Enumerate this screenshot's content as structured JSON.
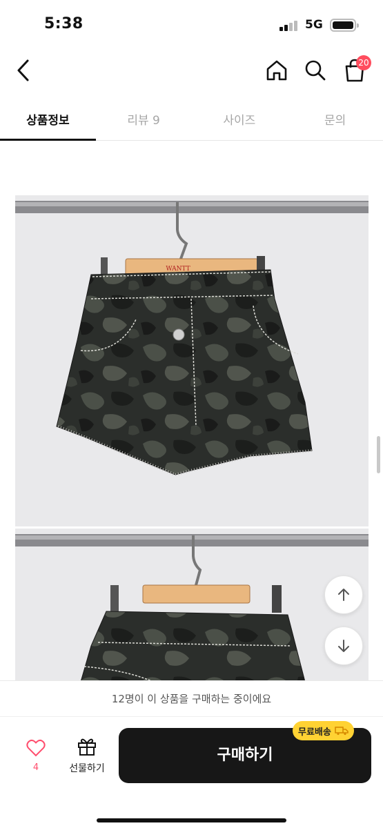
{
  "status_bar": {
    "time": "5:38",
    "network": "5G"
  },
  "header": {
    "back_icon": "chevron-left-icon",
    "home_icon": "home-icon",
    "search_icon": "search-icon",
    "cart_icon": "shopping-bag-icon",
    "cart_count": "20"
  },
  "tabs": [
    {
      "label": "상품정보",
      "active": true
    },
    {
      "label": "리뷰 9",
      "active": false
    },
    {
      "label": "사이즈",
      "active": false
    },
    {
      "label": "문의",
      "active": false
    }
  ],
  "product_images": {
    "hanger_brand": "WANTT"
  },
  "scroll_buttons": {
    "up_icon": "arrow-up-icon",
    "down_icon": "arrow-down-icon"
  },
  "bottom_bar": {
    "viewers_text": "12명이 이 상품을 구매하는 중이에요",
    "like_count": "4",
    "gift_label": "선물하기",
    "buy_label": "구매하기",
    "free_shipping_label": "무료배송"
  },
  "colors": {
    "accent_red": "#ff4d5e",
    "buy_button": "#171717",
    "shipping_badge": "#ffd233"
  }
}
